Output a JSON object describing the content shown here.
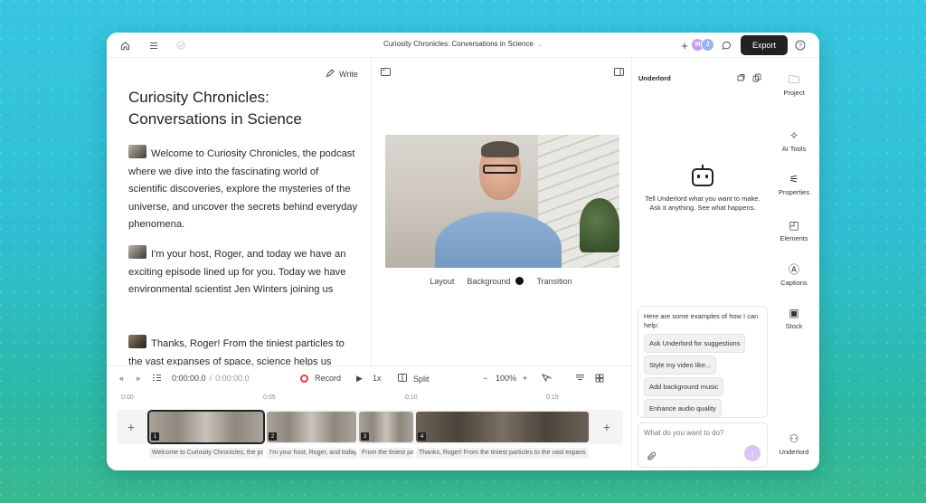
{
  "topbar": {
    "title": "Curiosity Chronicles: Conversations in Science",
    "export_label": "Export",
    "avatars": [
      {
        "initial": "M",
        "color": "#c59df2"
      },
      {
        "initial": "J",
        "color": "#9ab4f5"
      }
    ]
  },
  "script": {
    "write_label": "Write",
    "title": "Curiosity Chronicles: Conversations in Science",
    "paragraphs": [
      "Welcome to Curiosity Chronicles, the podcast where we dive into the fascinating world of scientific discoveries, explore the mysteries of the universe, and uncover the secrets behind everyday phenomena.",
      "I'm your host, Roger, and today we have an exciting episode lined up for you. Today we have environmental scientist Jen Winters joining us",
      "Thanks, Roger! From the tiniest particles to the vast expanses of space, science helps us"
    ]
  },
  "preview": {
    "layout_label": "Layout",
    "background_label": "Background",
    "transition_label": "Transition",
    "background_color": "#111111"
  },
  "timeline": {
    "time_current": "0:00:00.0",
    "time_sep": "/",
    "time_total": "0:00:00.0",
    "record_label": "Record",
    "speed_label": "1x",
    "split_label": "Split",
    "zoom_label": "100%",
    "ruler": [
      "0:00",
      "0:05",
      "0:10",
      "0:15"
    ],
    "clips": [
      {
        "num": "1"
      },
      {
        "num": "2"
      },
      {
        "num": "3"
      },
      {
        "num": "4"
      }
    ],
    "captions": [
      "Welcome to Curiosity Chronicles, the po",
      "I'm your host, Roger, and today",
      "From the tiniest pa",
      "Thanks, Roger! From the tiniest particles to the vast expans"
    ]
  },
  "underlord": {
    "label": "Underlord",
    "intro": "Tell Underlord what you want to make. Ask it anything. See what happens.",
    "examples_intro": "Here are some examples of how I can help:",
    "examples": [
      "Ask Underlord for suggestions",
      "Style my video like...",
      "Add background music",
      "Enhance audio quality"
    ],
    "ask_placeholder": "What do you want to do?"
  },
  "sidebar": {
    "items": [
      {
        "label": "Project",
        "icon": "folder-icon",
        "glyph": "🗀"
      },
      {
        "label": "AI Tools",
        "icon": "sparkle-icon",
        "glyph": "✧"
      },
      {
        "label": "Properties",
        "icon": "sliders-icon",
        "glyph": "⚟"
      },
      {
        "label": "Elements",
        "icon": "shapes-icon",
        "glyph": "◰"
      },
      {
        "label": "Captions",
        "icon": "captions-icon",
        "glyph": "Ⓐ"
      },
      {
        "label": "Stock",
        "icon": "stock-media-icon",
        "glyph": "▣"
      },
      {
        "label": "Underlord",
        "icon": "robot-icon",
        "glyph": "⚇"
      }
    ]
  }
}
